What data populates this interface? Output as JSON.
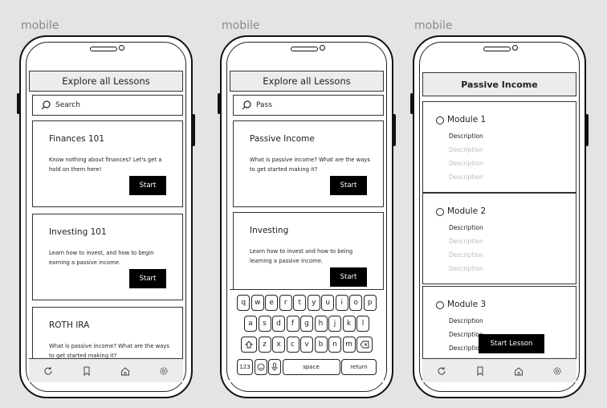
{
  "labels": {
    "device": "mobile"
  },
  "phone1": {
    "header": "Explore all Lessons",
    "search_placeholder": "Search",
    "cards": [
      {
        "title": "Finances 101",
        "desc": "Know nothing about finances? Let's get a hold on them here!",
        "button": "Start"
      },
      {
        "title": "Investing 101",
        "desc": "Learn how to invest, and how to begin earning a passive income.",
        "button": "Start"
      },
      {
        "title": "ROTH IRA",
        "desc": "What is passive income? What are the ways to get started making it?"
      }
    ]
  },
  "phone2": {
    "header": "Explore all Lessons",
    "search_value": "Pass",
    "cards": [
      {
        "title": "Passive Income",
        "desc": "What is passive income? What are the ways to get started making it?",
        "button": "Start"
      },
      {
        "title": "Investing",
        "desc": "Learn how to invest and how to being learning a passive income.",
        "button": "Start"
      }
    ],
    "keyboard": {
      "row1": [
        "q",
        "w",
        "e",
        "r",
        "t",
        "y",
        "u",
        "i",
        "o",
        "p"
      ],
      "row2": [
        "a",
        "s",
        "d",
        "f",
        "g",
        "h",
        "j",
        "k",
        "l"
      ],
      "row3": [
        "z",
        "x",
        "c",
        "v",
        "b",
        "n",
        "m"
      ],
      "numbers": "123",
      "space": "space",
      "return": "return"
    }
  },
  "phone3": {
    "header": "Passive Income",
    "modules": [
      {
        "title": "Module 1",
        "descriptions": [
          "Description",
          "Description",
          "Description",
          "Description"
        ]
      },
      {
        "title": "Module 2",
        "descriptions": [
          "Description",
          "Description",
          "Description",
          "Description"
        ]
      },
      {
        "title": "Module 3",
        "descriptions": [
          "Description",
          "Description",
          "Description"
        ]
      }
    ],
    "cta": "Start Lesson"
  },
  "icons": {
    "tabbar": [
      "refresh-icon",
      "bookmark-icon",
      "home-icon",
      "settings-icon"
    ]
  }
}
